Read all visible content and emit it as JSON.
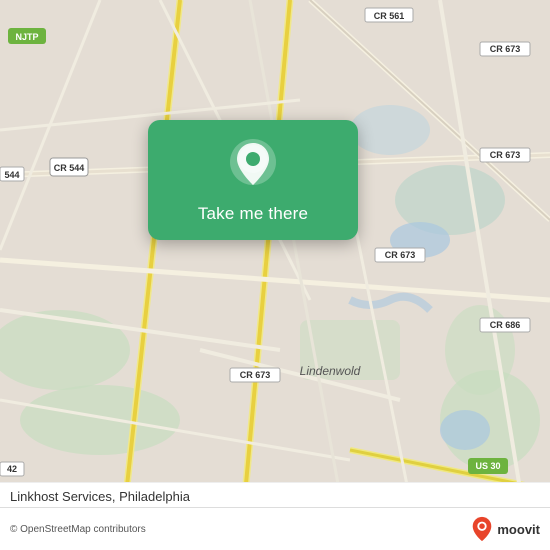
{
  "map": {
    "background_color": "#e4ddd4",
    "road_color": "#f5f0e8",
    "highway_color": "#f5c842",
    "water_color": "#b8d4e8",
    "green_color": "#c8ddc0"
  },
  "popup": {
    "background_color": "#3dab6e",
    "button_label": "Take me there",
    "icon": "location-pin-icon"
  },
  "labels": {
    "njtp": "NJTP",
    "cr544": "CR 544",
    "cr_544_left": "544",
    "cr673_top": "CR 673",
    "cr673_right": "CR 673",
    "cr673_mid": "CR 673",
    "cr673_bot": "CR 673",
    "cr561": "CR 561",
    "cr": "CR",
    "us30": "US 30",
    "cr686": "CR 686",
    "lindenwold": "Lindenwold"
  },
  "bottom_bar": {
    "attribution": "© OpenStreetMap contributors",
    "location_name": "Linkhost Services, Philadelphia",
    "moovit_label": "moovit"
  }
}
